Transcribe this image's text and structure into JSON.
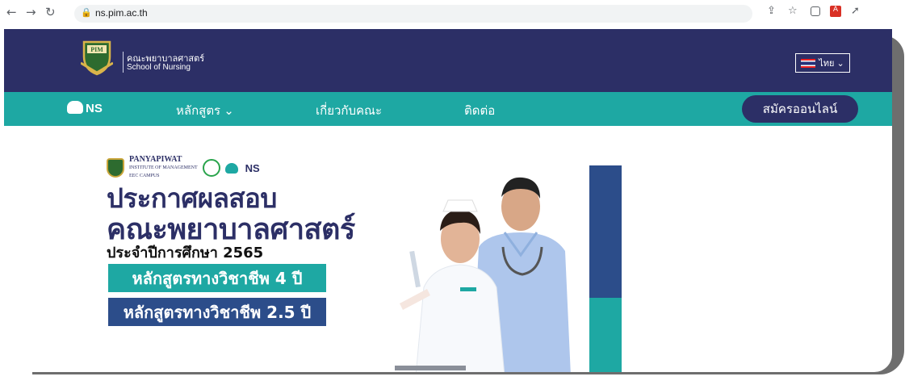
{
  "browser": {
    "url": "ns.pim.ac.th",
    "back_icon": "back-arrow-icon",
    "forward_icon": "forward-arrow-icon",
    "reload_icon": "reload-icon"
  },
  "header": {
    "faculty_th": "คณะพยาบาลศาสตร์",
    "faculty_en": "School of Nursing",
    "lang_label": "ไทย ⌄",
    "logo_text": "PIM"
  },
  "nav": {
    "brand": "NS",
    "items": [
      {
        "label": "หลักสูตร ⌄"
      },
      {
        "label": "เกี่ยวกับคณะ"
      },
      {
        "label": "ติดต่อ"
      }
    ],
    "apply_label": "สมัครออนไลน์"
  },
  "banner": {
    "partner_name": "PANYAPIWAT",
    "partner_sub": "INSTITUTE OF MANAGEMENT",
    "partner_sub2": "EEC CAMPUS",
    "partner_ns": "NS",
    "headline1": "ประกาศผลสอบ",
    "headline2": "คณะพยาบาลศาสตร์",
    "subline": "ประจำปีการศึกษา 2565",
    "program1": "หลักสูตรทางวิชาชีพ 4 ปี",
    "program2": "หลักสูตรทางวิชาชีพ 2.5 ปี"
  },
  "colors": {
    "navy": "#2c2f66",
    "teal": "#1ea8a3",
    "blue": "#2c4d8a"
  }
}
